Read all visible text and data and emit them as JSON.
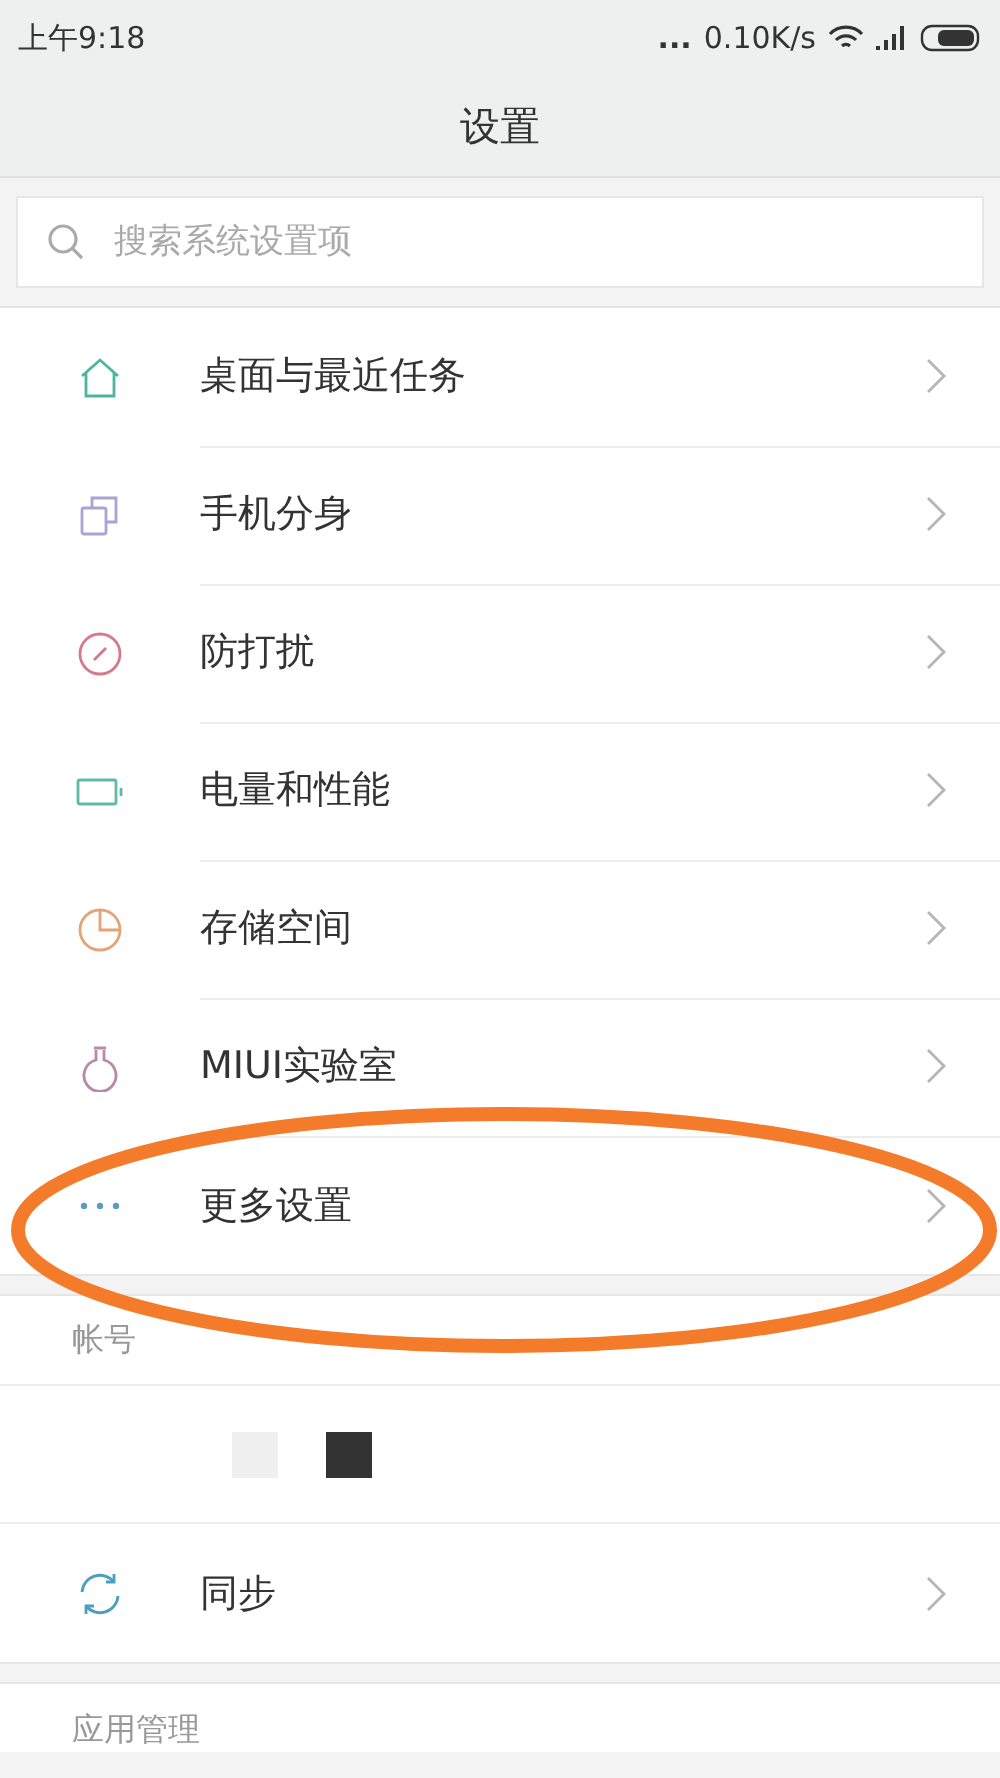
{
  "status_bar": {
    "time": "上午9:18",
    "dots": "...",
    "speed": "0.10K/s"
  },
  "title": "设置",
  "search": {
    "placeholder": "搜索系统设置项"
  },
  "items": [
    {
      "kind": "home",
      "label": "桌面与最近任务",
      "color": "#4cb5a0"
    },
    {
      "kind": "clone",
      "label": "手机分身",
      "color": "#a9a4d3"
    },
    {
      "kind": "dnd",
      "label": "防打扰",
      "color": "#d47a8a"
    },
    {
      "kind": "battery",
      "label": "电量和性能",
      "color": "#5fb8a8"
    },
    {
      "kind": "storage",
      "label": "存储空间",
      "color": "#e3a477"
    },
    {
      "kind": "flask",
      "label": "MIUI实验室",
      "color": "#b88aa8"
    },
    {
      "kind": "more",
      "label": "更多设置",
      "color": "#5a9fc0"
    }
  ],
  "account_section": {
    "header": "帐号"
  },
  "sync_item": {
    "kind": "sync",
    "label": "同步",
    "color": "#4a9ec0"
  },
  "apps_section": {
    "header": "应用管理"
  },
  "annotation": {
    "kind": "ellipse"
  }
}
